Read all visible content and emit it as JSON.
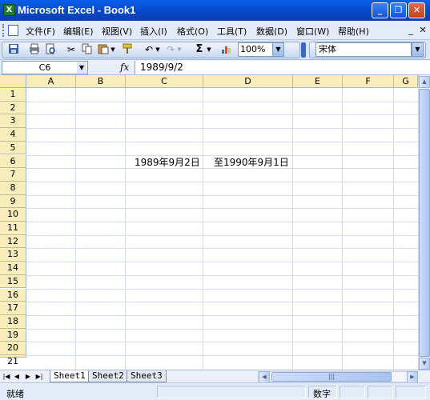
{
  "window": {
    "title": "Microsoft Excel - Book1",
    "minimize": "_",
    "restore": "❐",
    "close": "✕"
  },
  "menu": {
    "items": [
      "文件(F)",
      "编辑(E)",
      "视图(V)",
      "插入(I)",
      "格式(O)",
      "工具(T)",
      "数据(D)",
      "窗口(W)",
      "帮助(H)"
    ],
    "mdi_buttons": [
      "_",
      "✕"
    ]
  },
  "toolbar": {
    "icons": [
      "save-icon",
      "print-icon",
      "print-preview-icon",
      "cut-icon",
      "copy-icon",
      "paste-icon",
      "format-painter-icon",
      "undo-icon",
      "redo-icon",
      "autosum-icon",
      "chart-wizard-icon"
    ],
    "autosum_glyph": "Σ",
    "zoom": "100%",
    "font": "宋体"
  },
  "formula_bar": {
    "name_box": "C6",
    "fx_label": "fx",
    "value": "1989/9/2"
  },
  "sheet": {
    "columns": [
      "A",
      "B",
      "C",
      "D",
      "E",
      "F",
      "G"
    ],
    "rows": [
      "1",
      "2",
      "3",
      "4",
      "5",
      "6",
      "7",
      "8",
      "9",
      "10",
      "11",
      "12",
      "13",
      "14",
      "15",
      "16",
      "17",
      "18",
      "19",
      "20",
      "21"
    ],
    "cells": {
      "C6": "1989年9月2日",
      "D6": "至1990年9月1日"
    }
  },
  "tabs": {
    "nav": [
      "|◀",
      "◀",
      "▶",
      "▶|"
    ],
    "sheets": [
      "Sheet1",
      "Sheet2",
      "Sheet3"
    ],
    "active": "Sheet1",
    "hscroll_glyph": "||| "
  },
  "status": {
    "text": "就绪",
    "numlock": "数字"
  },
  "colors": {
    "title_bar": "#0a5ee8",
    "header_fill": "#f9edbb",
    "grid_line": "#d6dde8",
    "menu_bg": "#e3ebf9"
  }
}
